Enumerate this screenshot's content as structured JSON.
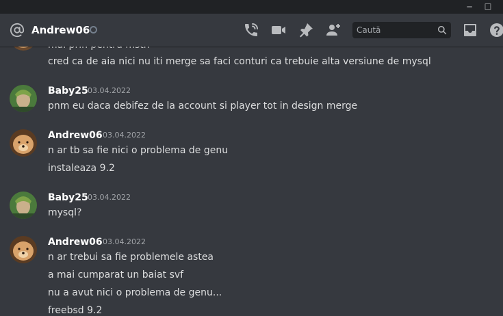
{
  "window": {
    "minimize_label": "─",
    "maximize_label": "☐"
  },
  "header": {
    "title": "Andrew06",
    "icons": [
      "at-icon",
      "phone-call-icon",
      "video-camera-icon",
      "pin-icon",
      "add-friend-icon",
      "inbox-icon",
      "help-icon"
    ],
    "search_placeholder": "Caută"
  },
  "messages": {
    "partial_top": "mai prin pentru mstn",
    "line0": "cred ca de aia nici nu iti merge sa faci conturi ca trebuie alta versiune de mysql",
    "groups": [
      {
        "author": "Baby25",
        "timestamp": "03.04.2022",
        "lines": [
          "pnm eu daca debifez de la account si player tot in design merge"
        ]
      },
      {
        "author": "Andrew06",
        "timestamp": "03.04.2022",
        "lines": [
          "n ar tb sa fie nici o problema de genu",
          "instaleaza 9.2"
        ]
      },
      {
        "author": "Baby25",
        "timestamp": "03.04.2022",
        "lines": [
          "mysql?"
        ]
      },
      {
        "author": "Andrew06",
        "timestamp": "03.04.2022",
        "lines": [
          "n ar trebui sa fie problemele astea",
          "a mai cumparat un baiat svf",
          "nu a avut nici o problema de genu...",
          "freebsd 9.2"
        ]
      }
    ]
  },
  "colors": {
    "background": "#36393f",
    "titlebar": "#202225",
    "text": "#dcddde",
    "muted": "#a3a6aa"
  }
}
